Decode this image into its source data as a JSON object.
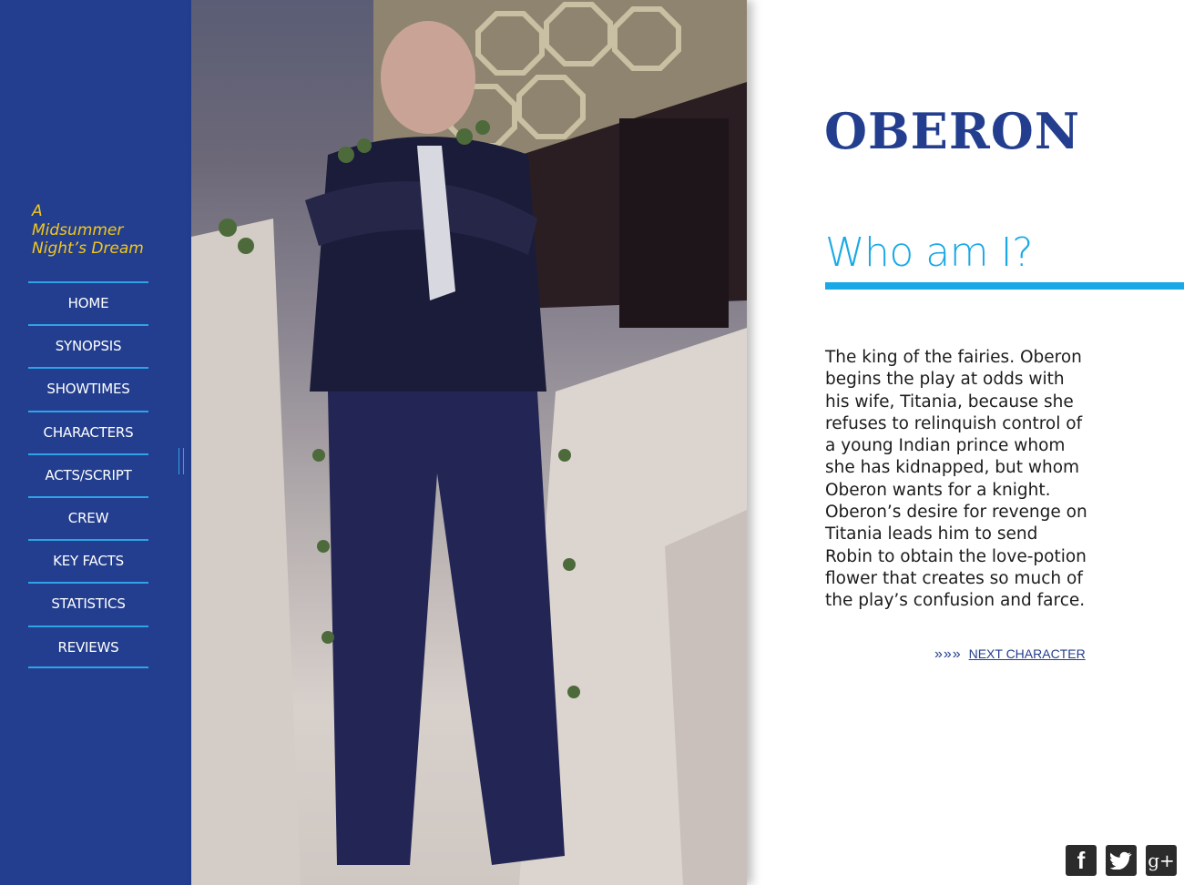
{
  "sidebar": {
    "site_title_line1": "A",
    "site_title_line2": "Midsummer",
    "site_title_line3": "Night’s Dream",
    "nav": [
      {
        "label": "HOME"
      },
      {
        "label": "SYNOPSIS"
      },
      {
        "label": "SHOWTIMES"
      },
      {
        "label": "CHARACTERS"
      },
      {
        "label": "ACTS/SCRIPT"
      },
      {
        "label": "CREW"
      },
      {
        "label": "KEY FACTS"
      },
      {
        "label": "STATISTICS"
      },
      {
        "label": "REVIEWS"
      }
    ]
  },
  "character": {
    "name": "OBERON",
    "section_title": "Who am I?",
    "bio": "The king of the fairies. Oberon begins the play at odds with his wife, Titania, because she refuses to relinquish control of a young Indian prince whom she has kidnapped, but whom Oberon wants for a knight. Oberon’s desire for revenge on Titania leads him to send Robin to obtain the love-potion flower that creates so much of the play’s confusion and farce.",
    "next_arrows": "»»»",
    "next_label": "NEXT CHARACTER"
  },
  "social": {
    "facebook_glyph": "f",
    "googleplus_glyph": "g+"
  },
  "colors": {
    "sidebar": "#233e8f",
    "accent": "#1aa9e6",
    "title_yellow": "#f2c81b"
  }
}
